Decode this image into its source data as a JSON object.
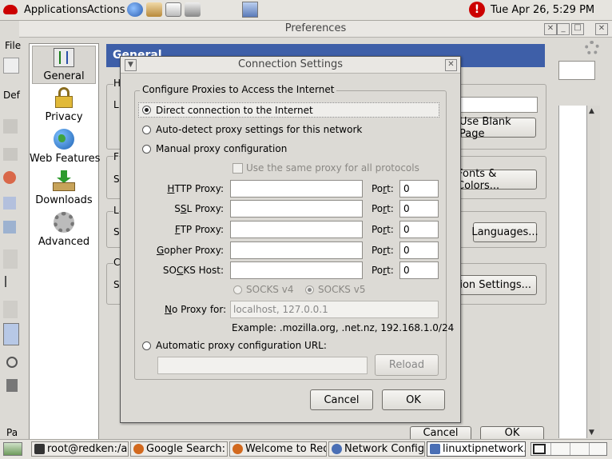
{
  "top_panel": {
    "applications": "Applications",
    "actions": "Actions",
    "clock": "Tue Apr 26,  5:29 PM"
  },
  "preferences": {
    "title": "Preferences",
    "left_menu_partial": "File",
    "general_header": "General",
    "categories": [
      {
        "label": "General",
        "icon": "general-sliders-icon"
      },
      {
        "label": "Privacy",
        "icon": "padlock-icon"
      },
      {
        "label": "Web Features",
        "icon": "globe-icon"
      },
      {
        "label": "Downloads",
        "icon": "download-box-icon"
      },
      {
        "label": "Advanced",
        "icon": "gear-icon"
      }
    ],
    "use_blank_page": "Use Blank Page",
    "fonts_colors": "Fonts & Colors...",
    "languages": "Languages...",
    "connection_settings": "ection Settings...",
    "cancel": "Cancel",
    "ok": "OK",
    "partial_letters": {
      "h": "H",
      "l": "L",
      "f": "F",
      "s": "S",
      "l2": "L",
      "s2": "S",
      "c": "C",
      "s3": "S",
      "def": "Def",
      "pa": "Pa"
    }
  },
  "dialog": {
    "title": "Connection Settings",
    "group_label": "Configure Proxies to Access the Internet",
    "radio_direct": "Direct connection to the Internet",
    "radio_auto": "Auto-detect proxy settings for this network",
    "radio_manual": "Manual proxy configuration",
    "same_proxy": "Use the same proxy for all protocols",
    "proxies": [
      {
        "pre": "",
        "u": "H",
        "post": "TTP Proxy:",
        "port": "0"
      },
      {
        "pre": "S",
        "u": "S",
        "post": "L Proxy:",
        "port": "0"
      },
      {
        "pre": "",
        "u": "F",
        "post": "TP Proxy:",
        "port": "0"
      },
      {
        "pre": "",
        "u": "G",
        "post": "opher Proxy:",
        "port": "0"
      },
      {
        "pre": "SO",
        "u": "C",
        "post": "KS Host:",
        "port": "0"
      }
    ],
    "port_label": {
      "pre": "Po",
      "u": "r",
      "post": "t:"
    },
    "socks_v4": "SOCKS v4",
    "socks_v5": "SOCKS v5",
    "no_proxy_label": {
      "u": "N",
      "post": "o Proxy for:"
    },
    "no_proxy_value": "localhost, 127.0.0.1",
    "example": "Example: .mozilla.org, .net.nz, 192.168.1.0/24",
    "radio_auto_url": "Automatic proxy configuration URL:",
    "reload": "Reload",
    "cancel": "Cancel",
    "ok": "OK"
  },
  "taskbar": [
    {
      "label": "root@redken:/app",
      "icon": "terminal-icon"
    },
    {
      "label": "Google Search: rh",
      "icon": "browser-icon"
    },
    {
      "label": "Welcome to Red H",
      "icon": "browser-icon"
    },
    {
      "label": "Network Configur",
      "icon": "network-icon"
    },
    {
      "label": "linuxtipnetwork.sx",
      "icon": "document-icon"
    }
  ],
  "colors": {
    "accent": "#3e5fa8",
    "alert": "#cc0000"
  }
}
